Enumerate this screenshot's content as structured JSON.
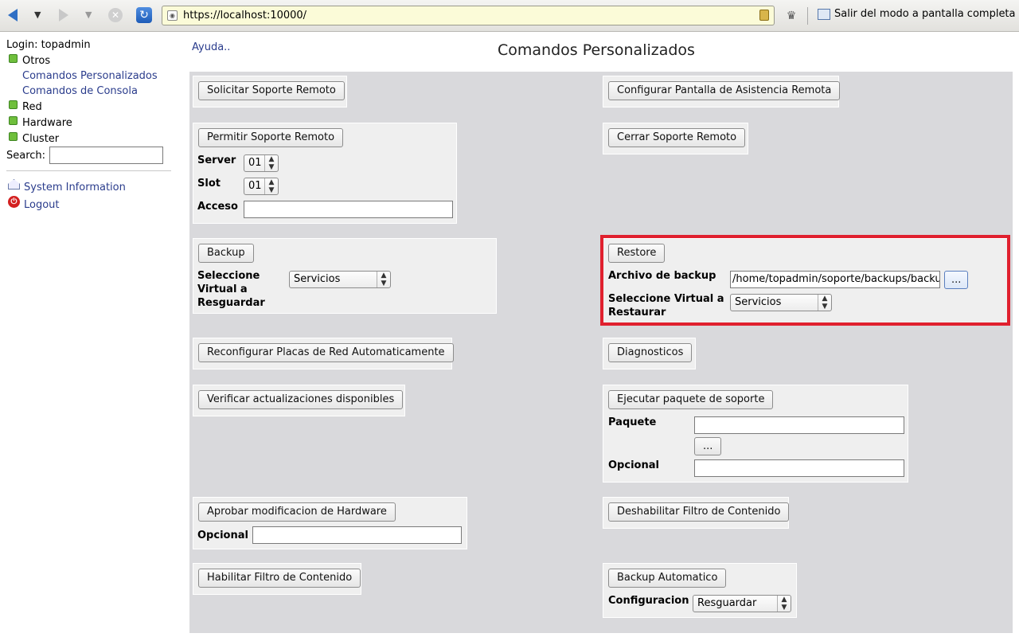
{
  "browser": {
    "url": "https://localhost:10000/",
    "exit_fullscreen_label": "Salir del modo a pantalla completa"
  },
  "sidebar": {
    "login": "Login: topadmin",
    "otros": "Otros",
    "comandos_personalizados": "Comandos Personalizados",
    "comandos_consola": "Comandos de Consola",
    "red": "Red",
    "hardware": "Hardware",
    "cluster": "Cluster",
    "search_label": "Search:",
    "search_value": "",
    "system_information": "System Information",
    "logout": "Logout"
  },
  "header": {
    "help": "Ayuda..",
    "title": "Comandos Personalizados"
  },
  "commands": {
    "solicitar_soporte": "Solicitar Soporte Remoto",
    "configurar_pantalla": "Configurar Pantalla de Asistencia Remota",
    "permitir_soporte": "Permitir Soporte Remoto",
    "server_label": "Server",
    "server_value": "01",
    "slot_label": "Slot",
    "slot_value": "01",
    "acceso_label": "Acceso",
    "acceso_value": "",
    "cerrar_soporte": "Cerrar Soporte Remoto",
    "backup": "Backup",
    "seleccione_virtual_resguardar": "Seleccione Virtual a Resguardar",
    "backup_virtual_value": "Servicios",
    "restore": "Restore",
    "archivo_backup_label": "Archivo de backup",
    "archivo_backup_value": "/home/topadmin/soporte/backups/backu",
    "browse": "...",
    "seleccione_virtual_restaurar": "Seleccione Virtual a Restaurar",
    "restore_virtual_value": "Servicios",
    "reconfigurar_placas": "Reconfigurar Placas de Red Automaticamente",
    "diagnosticos": "Diagnosticos",
    "verificar_actualizaciones": "Verificar actualizaciones disponibles",
    "ejecutar_paquete": "Ejecutar paquete de soporte",
    "paquete_label": "Paquete",
    "paquete_value": "",
    "paquete_browse": "...",
    "opcional_label": "Opcional",
    "opcional_value": "",
    "aprobar_hardware": "Aprobar modificacion de Hardware",
    "aprobar_opcional_label": "Opcional",
    "aprobar_opcional_value": "",
    "deshabilitar_filtro": "Deshabilitar Filtro de Contenido",
    "habilitar_filtro": "Habilitar Filtro de Contenido",
    "backup_automatico": "Backup Automatico",
    "configuracion_label": "Configuracion",
    "configuracion_value": "Resguardar"
  }
}
